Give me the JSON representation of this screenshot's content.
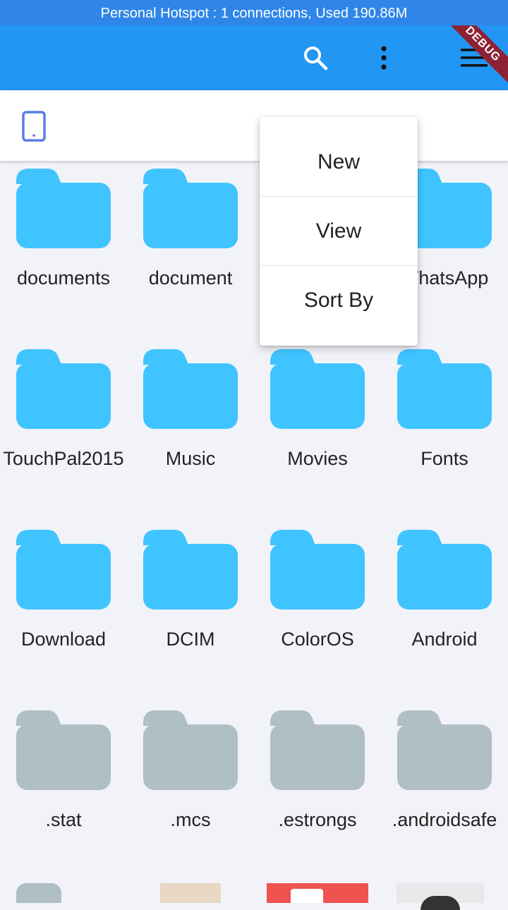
{
  "status_bar": {
    "text": "Personal Hotspot : 1 connections, Used 190.86M"
  },
  "app_bar": {
    "color": "#2196f3",
    "icons": [
      "search-icon",
      "more-vert-icon",
      "menu-icon"
    ],
    "debug_banner": "DEBUG"
  },
  "path_bar": {
    "icon": "phone-icon"
  },
  "menu": {
    "items": [
      {
        "label": "New"
      },
      {
        "label": "View"
      },
      {
        "label": "Sort By"
      }
    ]
  },
  "folders": [
    {
      "name": "documents",
      "color": "#40c4ff"
    },
    {
      "name": "document",
      "color": "#40c4ff"
    },
    {
      "name": "",
      "color": "#40c4ff"
    },
    {
      "name": "WhatsApp",
      "color": "#40c4ff"
    },
    {
      "name": "TouchPal2015",
      "color": "#40c4ff"
    },
    {
      "name": "Music",
      "color": "#40c4ff"
    },
    {
      "name": "Movies",
      "color": "#40c4ff"
    },
    {
      "name": "Fonts",
      "color": "#40c4ff"
    },
    {
      "name": "Download",
      "color": "#40c4ff"
    },
    {
      "name": "DCIM",
      "color": "#40c4ff"
    },
    {
      "name": "ColorOS",
      "color": "#40c4ff"
    },
    {
      "name": "Android",
      "color": "#40c4ff"
    },
    {
      "name": ".stat",
      "color": "#b0bec5"
    },
    {
      "name": ".mcs",
      "color": "#b0bec5"
    },
    {
      "name": ".estrongs",
      "color": "#b0bec5"
    },
    {
      "name": ".androidsafe",
      "color": "#b0bec5"
    }
  ]
}
